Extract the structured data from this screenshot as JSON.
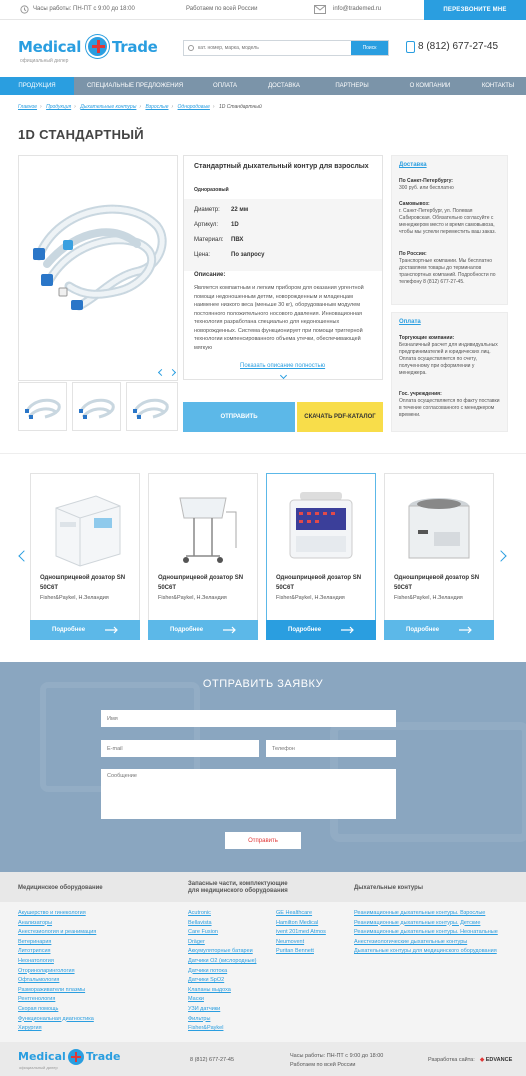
{
  "topbar": {
    "hours": "Часы работы: ПН-ПТ с 9:00 до 18:00",
    "region": "Работаем по всей России",
    "email": "info@trademed.ru",
    "call_button": "ПЕРЕЗВОНИТЕ МНЕ"
  },
  "header": {
    "logo_word1": "Medical",
    "logo_word2": "Trade",
    "logo_sub": "официальный дилер",
    "search_placeholder": "кат. номер, марка, модель",
    "search_button": "Поиск",
    "phone": "8 (812) 677-27-45"
  },
  "nav": [
    "ПРОДУКЦИЯ",
    "СПЕЦИАЛЬНЫЕ ПРЕДЛОЖЕНИЯ",
    "ОПЛАТА",
    "ДОСТАВКА",
    "ПАРТНЕРЫ",
    "О КОМПАНИИ",
    "КОНТАКТЫ"
  ],
  "breadcrumbs": [
    "Главное",
    "Продукция",
    "Дыхательные контуры",
    "Взрослые",
    "Однородовые",
    "1D Стандартный"
  ],
  "page_title": "1D СТАНДАРТНЫЙ",
  "product": {
    "title": "Стандартный дыхательный контур для взрослых",
    "subtitle": "Одноразовый",
    "specs": [
      {
        "label": "Диаметр:",
        "value": "22 мм"
      },
      {
        "label": "Артикул:",
        "value": "1D"
      },
      {
        "label": "Материал:",
        "value": "ПВХ"
      },
      {
        "label": "Цена:",
        "value": "По запросу"
      }
    ],
    "desc_label": "Описание:",
    "description": "Является компактным и легким прибором для оказания ургентной помощи недоношенным детям, новорожденным и младенцам наименее низкого веса (меньше 30 кг), оборудованным модулем постоянного положительного носового давления. Инновационная технология разработана специально для недоношенных новорожденных. Система функционирует при помощи триггерной технологии компенсированного объема утечки, обеспечивающей мягкую",
    "more_link": "Показать описание полностью",
    "send_button": "ОТПРАВИТЬ",
    "pdf_button": "СКАЧАТЬ PDF-КАТАЛОГ"
  },
  "delivery": {
    "heading": "Доставка",
    "spb_title": "По Санкт-Петербургу:",
    "spb_text": "300 руб. или бесплатно",
    "pickup_title": "Самовывоз:",
    "pickup_text": "г. Санкт-Петербург, ул. Полевая Сабировская. Обязательно согласуйте с менеджером место и время самовывоза, чтобы мы успели переместить ваш заказ.",
    "russia_title": "По России:",
    "russia_text": "Транспортные компании. Мы бесплатно доставляем товары до терминалов транспортных компаний. Подробности по телефону 8 (812) 677-27-45."
  },
  "payment": {
    "heading": "Оплата",
    "trade_title": "Торгующие компании:",
    "trade_text": "Безналичный расчет для индивидуальных предпринимателей и юридических лиц. Оплата осуществляется по счету, полученному при оформлении у менеджера.",
    "gov_title": "Гос. учреждения:",
    "gov_text": "Оплата осуществляется по факту поставки в течение согласованного с менеджером времени."
  },
  "carousel": {
    "items": [
      {
        "name": "Одношприцевой дозатор SN 50C6T",
        "maker": "Fisher&Paykel, Н.Зеландия",
        "button": "Подробнее"
      },
      {
        "name": "Одношприцевой дозатор SN 50C6T",
        "maker": "Fisher&Paykel, Н.Зеландия",
        "button": "Подробнее"
      },
      {
        "name": "Одношприцевой дозатор SN 50C6T",
        "maker": "Fisher&Paykel, Н.Зеландия",
        "button": "Подробнее"
      },
      {
        "name": "Одношприцевой дозатор SN 50C6T",
        "maker": "Fisher&Paykel, Н.Зеландия",
        "button": "Подробнее"
      }
    ]
  },
  "request_form": {
    "title": "ОТПРАВИТЬ ЗАЯВКУ",
    "name_placeholder": "Имя",
    "email_placeholder": "E-mail",
    "phone_placeholder": "Телефон",
    "message_placeholder": "Сообщение",
    "submit": "Отправить"
  },
  "footer": {
    "col1_title": "Медицинское оборудование",
    "col1_links": [
      "Акушерство и гинекология",
      "Анализаторы",
      "Анестезиология и реанимация",
      "Ветеринария",
      "Литотрипсия",
      "Неонатология",
      "Оториноларингология",
      "Офтальмология",
      "Размораживатели плазмы",
      "Рентгенология",
      "Скорая помощь",
      "Функциональная диагностика",
      "Хирургия"
    ],
    "col2_title": "Запасные части, комплектующие для медицинского оборудования",
    "col2_links_a": [
      "Acutronic",
      "Bellavista",
      "Care Fusion",
      "Dräger",
      "Аккумуляторные батареи",
      "Датчики O2 (кислородные)",
      "Датчики потока",
      "Датчики SpO2",
      "Клапаны выдоха",
      "Маски",
      "УЗИ датчики",
      "Фильтры",
      "Fisher&Paykel"
    ],
    "col2_links_b": [
      "GE Healthcare",
      "Hamilton Medical",
      "ivent 201med Atmos",
      "Neumovent",
      "Puritan Bennett"
    ],
    "col3_title": "Дыхательные контуры",
    "col3_links": [
      "Реанимационные дыхательные контуры. Взрослые",
      "Реанимационные дыхательные контуры. Детские",
      "Реанимационные дыхательные контуры. Неонатальные",
      "Анестезиологические дыхательные контуры",
      "Дыхательные контуры для медицинского оборудования"
    ],
    "phone": "8 (812) 677-27-45",
    "hours": "Часы работы: ПН-ПТ с 9:00 до 18:00",
    "region": "Работаем по всей России",
    "dev_label": "Разработка сайта:",
    "dev_brand": "EDVANCE"
  },
  "colors": {
    "accent": "#2a9ee0",
    "nav": "#7b94a9",
    "yellow": "#f8dd4a",
    "red": "#e03838"
  }
}
